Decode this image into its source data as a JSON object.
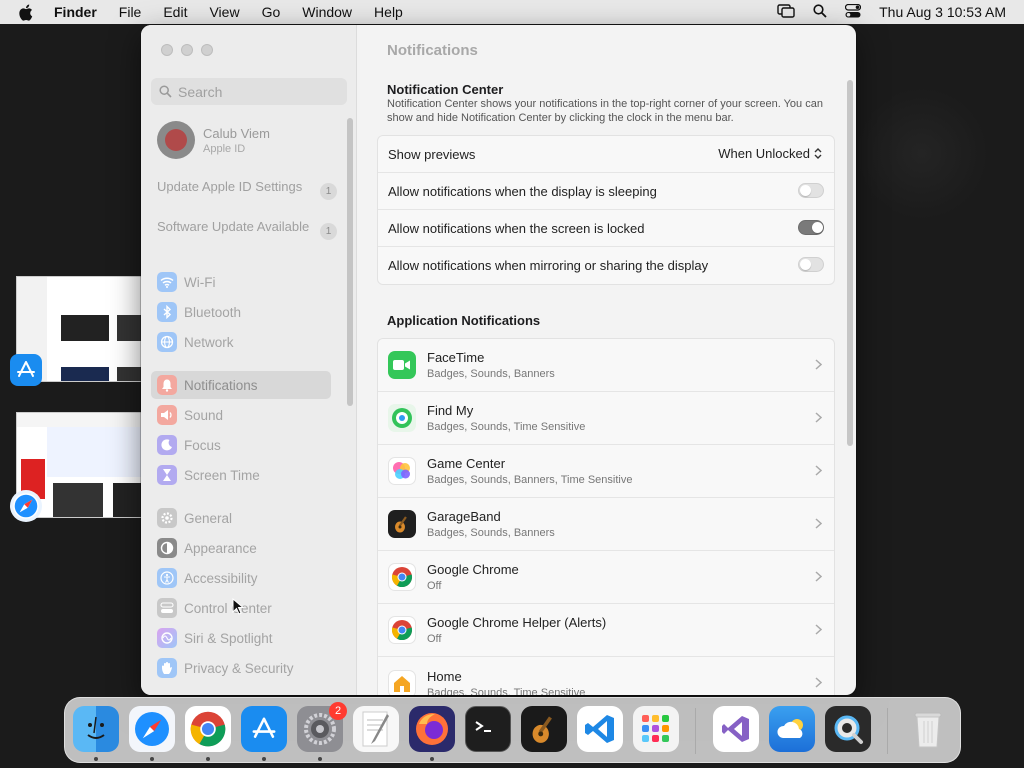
{
  "menubar": {
    "app": "Finder",
    "items": [
      "File",
      "Edit",
      "View",
      "Go",
      "Window",
      "Help"
    ],
    "clock": "Thu Aug 3  10:53 AM"
  },
  "sidebar": {
    "search_placeholder": "Search",
    "profile": {
      "name": "Calub Viem",
      "sub": "Apple ID"
    },
    "updates": [
      {
        "label": "Update Apple ID Settings",
        "count": "1"
      },
      {
        "label": "Software Update Available",
        "count": "1"
      }
    ],
    "items": [
      {
        "label": "Wi-Fi",
        "icon": "wifi-icon",
        "color": "#3a8ff5"
      },
      {
        "label": "Bluetooth",
        "icon": "bluetooth-icon",
        "color": "#3a8ff5"
      },
      {
        "label": "Network",
        "icon": "globe-icon",
        "color": "#3a8ff5"
      },
      {
        "label": "Notifications",
        "icon": "bell-icon",
        "color": "#f25a4a"
      },
      {
        "label": "Sound",
        "icon": "speaker-icon",
        "color": "#f25a4a"
      },
      {
        "label": "Focus",
        "icon": "moon-icon",
        "color": "#6a5ce0"
      },
      {
        "label": "Screen Time",
        "icon": "hourglass-icon",
        "color": "#6a5ce0"
      },
      {
        "label": "General",
        "icon": "gear-icon",
        "color": "#9a9a9a"
      },
      {
        "label": "Appearance",
        "icon": "appearance-icon",
        "color": "#333333"
      },
      {
        "label": "Accessibility",
        "icon": "accessibility-icon",
        "color": "#3a8ff5"
      },
      {
        "label": "Control Center",
        "icon": "control-center-icon",
        "color": "#9a9a9a"
      },
      {
        "label": "Siri & Spotlight",
        "icon": "siri-icon",
        "color": "#c060d8"
      },
      {
        "label": "Privacy & Security",
        "icon": "hand-icon",
        "color": "#3a8ff5"
      }
    ]
  },
  "main": {
    "title": "Notifications",
    "center_heading": "Notification Center",
    "center_desc": "Notification Center shows your notifications in the top-right corner of your screen. You can show and hide Notification Center by clicking the clock in the menu bar.",
    "show_previews_label": "Show previews",
    "show_previews_value": "When Unlocked",
    "toggles": [
      {
        "label": "Allow notifications when the display is sleeping",
        "on": false
      },
      {
        "label": "Allow notifications when the screen is locked",
        "on": true
      },
      {
        "label": "Allow notifications when mirroring or sharing the display",
        "on": false
      }
    ],
    "apps_heading": "Application Notifications",
    "apps": [
      {
        "name": "FaceTime",
        "sub": "Badges, Sounds, Banners",
        "icon": "facetime-icon"
      },
      {
        "name": "Find My",
        "sub": "Badges, Sounds, Time Sensitive",
        "icon": "findmy-icon"
      },
      {
        "name": "Game Center",
        "sub": "Badges, Sounds, Banners, Time Sensitive",
        "icon": "gamecenter-icon"
      },
      {
        "name": "GarageBand",
        "sub": "Badges, Sounds, Banners",
        "icon": "garageband-icon"
      },
      {
        "name": "Google Chrome",
        "sub": "Off",
        "icon": "chrome-icon"
      },
      {
        "name": "Google Chrome Helper (Alerts)",
        "sub": "Off",
        "icon": "chrome-icon"
      },
      {
        "name": "Home",
        "sub": "Badges, Sounds, Time Sensitive",
        "icon": "home-icon"
      }
    ]
  },
  "dock": {
    "system_settings_badge": "2"
  },
  "colors": {
    "accent": "#3a8ff5",
    "badge_red": "#ff3b30"
  }
}
